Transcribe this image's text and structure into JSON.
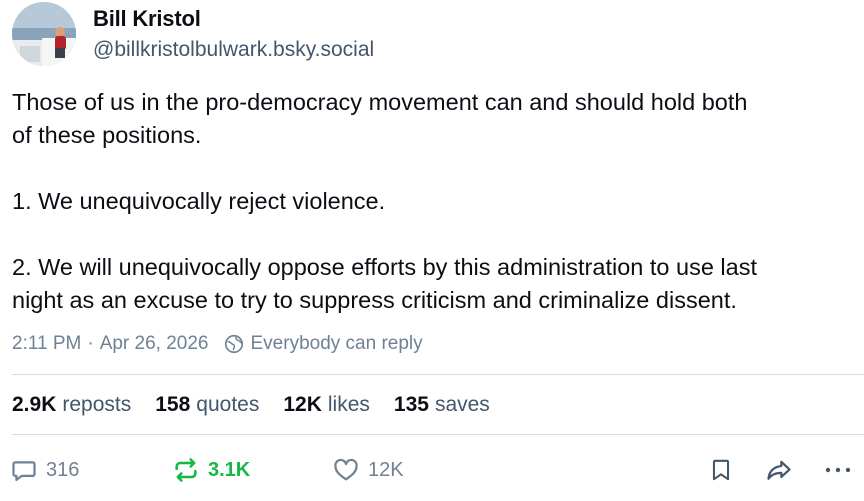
{
  "author": {
    "name": "Bill Kristol",
    "handle": "@billkristolbulwark.bsky.social"
  },
  "post": {
    "lines": [
      "Those of us in the pro-democracy movement can and should hold both",
      "of these positions.",
      "1. We unequivocally reject violence.",
      "2. We will unequivocally oppose efforts by this administration to use last",
      "night as an excuse to try to suppress criticism and criminalize dissent."
    ]
  },
  "meta": {
    "time": "2:11 PM",
    "separator": "·",
    "date": "Apr 26, 2026",
    "reply_setting": "Everybody can reply"
  },
  "stats": {
    "reposts": {
      "count": "2.9K",
      "label": "reposts"
    },
    "quotes": {
      "count": "158",
      "label": "quotes"
    },
    "likes": {
      "count": "12K",
      "label": "likes"
    },
    "saves": {
      "count": "135",
      "label": "saves"
    }
  },
  "actions": {
    "reply_count": "316",
    "repost_count": "3.1K",
    "like_count": "12K"
  },
  "colors": {
    "text": "#0b0f14",
    "secondary": "#42576c",
    "muted": "#6f8194",
    "repost_active": "#13b847",
    "divider": "#d4dbe2"
  },
  "icons": {
    "reply": "speech-bubble-icon",
    "repost": "repost-arrows-icon",
    "like": "heart-icon",
    "bookmark": "bookmark-icon",
    "share": "share-arrow-icon",
    "more": "ellipsis-icon",
    "reply_setting": "globe-icon"
  }
}
